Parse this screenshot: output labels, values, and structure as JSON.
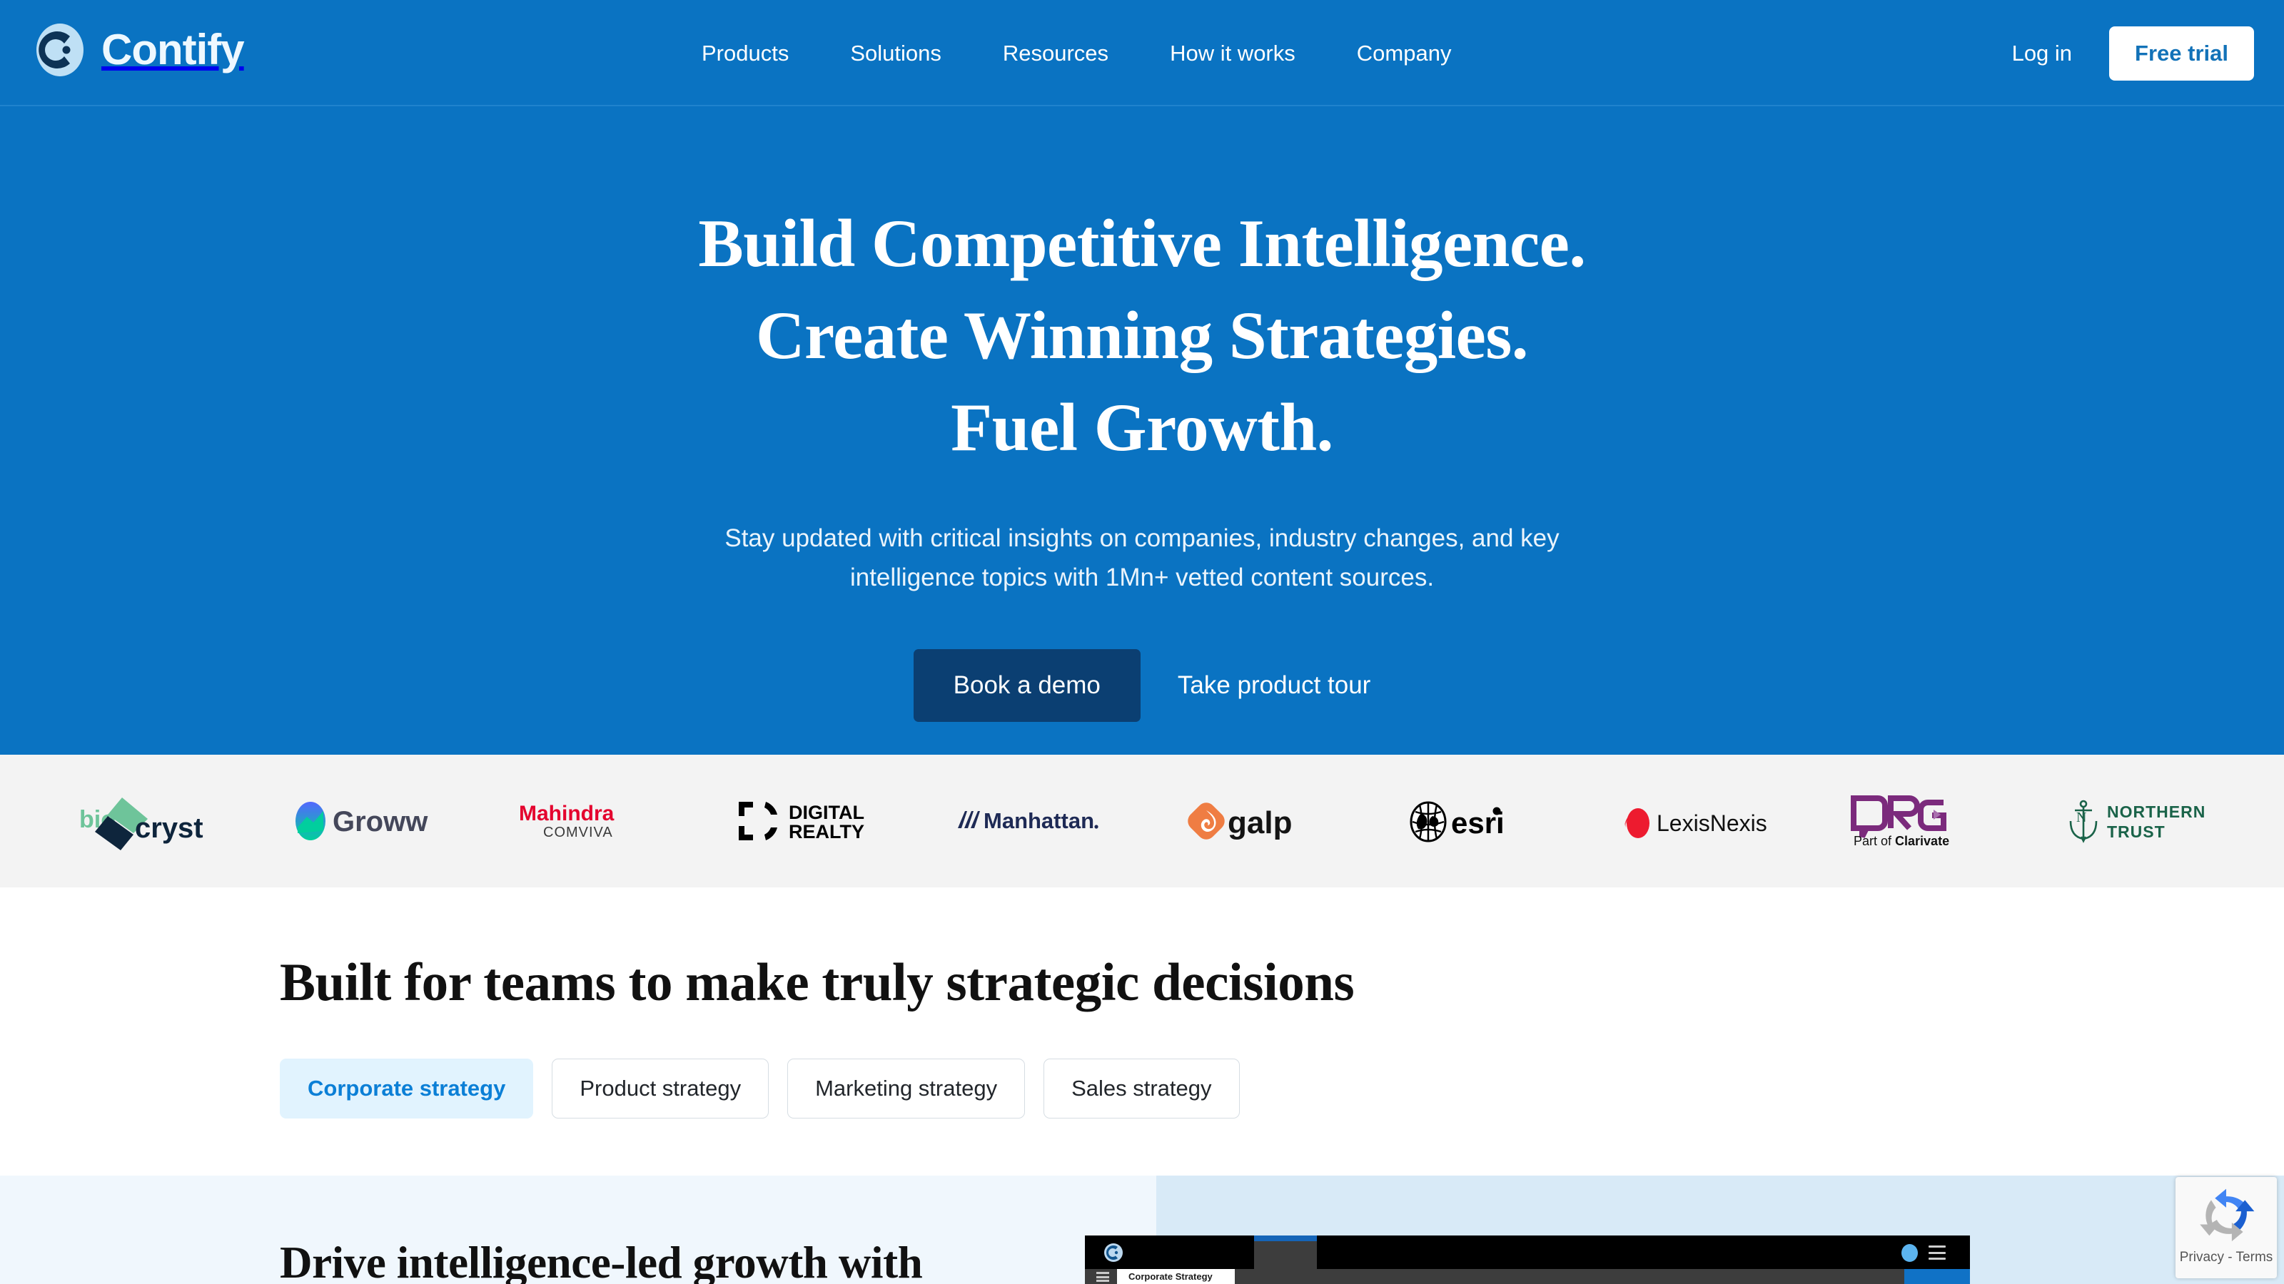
{
  "header": {
    "brand": "Contify",
    "brand_icon": "contify-circle-logo",
    "nav": [
      {
        "label": "Products"
      },
      {
        "label": "Solutions"
      },
      {
        "label": "Resources"
      },
      {
        "label": "How it works"
      },
      {
        "label": "Company"
      }
    ],
    "login_label": "Log in",
    "trial_label": "Free trial",
    "bg_color": "#0A73C2"
  },
  "hero": {
    "headline_line1": "Build Competitive Intelligence.",
    "headline_line2": "Create Winning Strategies.",
    "headline_line3": "Fuel Growth.",
    "subtitle_line1": "Stay updated with critical insights on companies, industry changes, and key",
    "subtitle_line2": "intelligence topics with 1Mn+ vetted content sources.",
    "primary_cta": "Book a demo",
    "secondary_cta": "Take product tour",
    "primary_cta_color": "#0B3F72"
  },
  "logos": {
    "bg_color": "#F3F3F3",
    "items": [
      {
        "name": "biocryst",
        "text": "biocryst",
        "color": "#17263b"
      },
      {
        "name": "groww",
        "text": "Groww",
        "color": "#44475a"
      },
      {
        "name": "mahindra-comviva",
        "text": "Mahindra",
        "sub": "COMVIVA",
        "color": "#e4032e"
      },
      {
        "name": "digital-realty",
        "text": "DIGITAL",
        "sub": "REALTY",
        "color": "#000000"
      },
      {
        "name": "manhattan",
        "text": "Manhattan",
        "color": "#1e2a55"
      },
      {
        "name": "galp",
        "text": "galp",
        "color": "#111111"
      },
      {
        "name": "esri",
        "text": "esri",
        "color": "#000000"
      },
      {
        "name": "lexisnexis",
        "text": "LexisNexis",
        "color": "#101010"
      },
      {
        "name": "drg",
        "text": "DRG",
        "sub": "Part of Clarivate",
        "color": "#7b2a7c"
      },
      {
        "name": "northern-trust",
        "text": "NORTHERN",
        "sub": "TRUST",
        "color": "#1a6349"
      }
    ]
  },
  "teams": {
    "heading": "Built for teams to make truly strategic decisions",
    "tabs": [
      {
        "label": "Corporate strategy",
        "active": true
      },
      {
        "label": "Product strategy",
        "active": false
      },
      {
        "label": "Marketing strategy",
        "active": false
      },
      {
        "label": "Sales strategy",
        "active": false
      }
    ],
    "active_tab_bg": "#E1F3FE",
    "active_tab_color": "#0B7FD6"
  },
  "bottom": {
    "heading": "Drive intelligence-led growth with",
    "panel_bg": "#F0F7FD",
    "panel_accent_bg": "#D8EAF7"
  },
  "mockup": {
    "app_tab_label": "Corporate Strategy",
    "logo_icon": "contify-circle-logo",
    "menu_icon": "hamburger-icon",
    "avatar_icon": "user-avatar",
    "accent_color": "#1072C6"
  },
  "recaptcha": {
    "label": "Privacy - Terms",
    "icon": "recaptcha-icon"
  }
}
